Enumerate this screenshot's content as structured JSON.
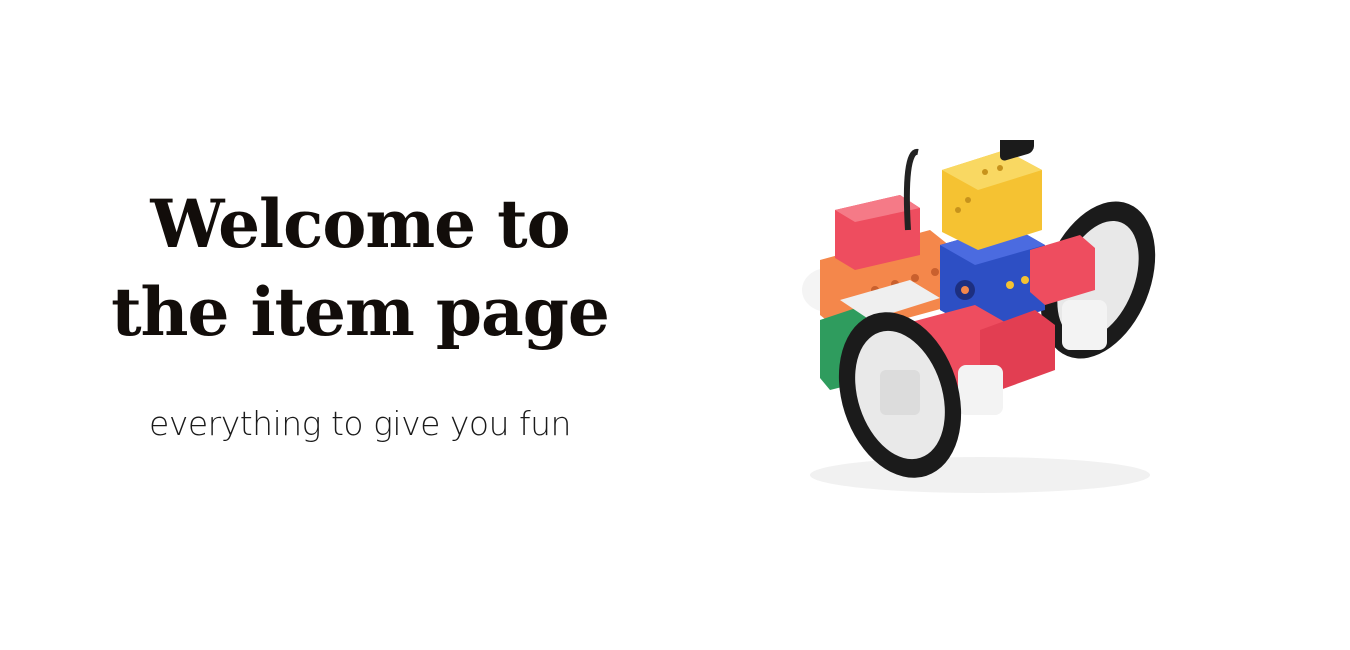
{
  "hero": {
    "title_line1": "Welcome to",
    "title_line2": "the item page",
    "subtitle": "everything to give you fun"
  },
  "product": {
    "image_icon": "robot-vehicle-kit-icon",
    "colors": {
      "yellow": "#f5c232",
      "blue": "#2d4fc4",
      "red": "#ee4d5f",
      "orange": "#f4874b",
      "green": "#2f9c5e",
      "white": "#f2f2f2",
      "tire": "#1b1b1b"
    }
  }
}
